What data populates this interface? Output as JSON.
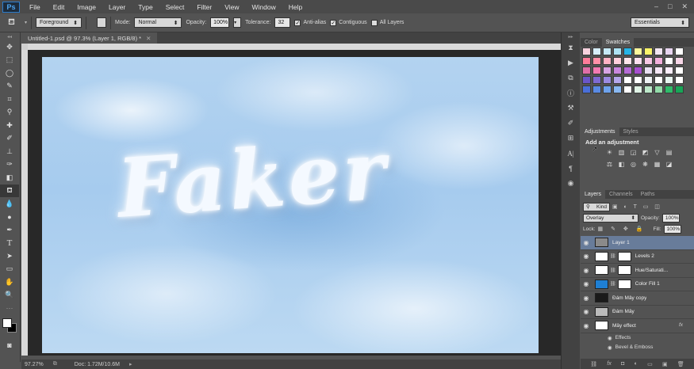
{
  "app": {
    "logo": "Ps"
  },
  "menu": [
    "File",
    "Edit",
    "Image",
    "Layer",
    "Type",
    "Select",
    "Filter",
    "View",
    "Window",
    "Help"
  ],
  "window_controls": [
    "–",
    "□",
    "✕"
  ],
  "options": {
    "fill_source": "Foreground",
    "mode_label": "Mode:",
    "mode_value": "Normal",
    "opacity_label": "Opacity:",
    "opacity_value": "100%",
    "tolerance_label": "Tolerance:",
    "tolerance_value": "32",
    "anti_alias": "Anti-alias",
    "contiguous": "Contiguous",
    "all_layers": "All Layers",
    "workspace": "Essentials"
  },
  "document": {
    "tab_title": "Untitled-1.psd @ 97.3% (Layer 1, RGB/8) *",
    "canvas_text": "Faker"
  },
  "status": {
    "zoom": "97.27%",
    "doc_info": "Doc: 1.72M/10.6M"
  },
  "color_panel": {
    "tab_color": "Color",
    "tab_swatches": "Swatches"
  },
  "swatch_colors": [
    "#f7d2de",
    "#d6eefa",
    "#c6e9f6",
    "#aee3f3",
    "#26b4e6",
    "#fff89c",
    "#fcf56a",
    "#f3e7f4",
    "#e8d5f0",
    "#ffffff",
    "#ff7c9a",
    "#ff90a8",
    "#ffb2c4",
    "#ffd0dc",
    "#ffe6ec",
    "#fde0f0",
    "#f8c8e6",
    "#f3b0dc",
    "#ffffff",
    "#f7d7e8",
    "#e06fa8",
    "#f27ab2",
    "#d8a4e3",
    "#c987de",
    "#b56bd6",
    "#a74fcf",
    "#e9e0f3",
    "#f5e7f6",
    "#fbeefc",
    "#ffffff",
    "#6a56c8",
    "#7e6ad2",
    "#9b8ae0",
    "#b4a6ea",
    "#ffffff",
    "#ffffff",
    "#eef2f4",
    "#ffffff",
    "#e6f4ef",
    "#ffffff",
    "#4a6fd8",
    "#5a8ae3",
    "#6ea2ec",
    "#89b8f1",
    "#ffffff",
    "#e0f4e6",
    "#bde9ca",
    "#92dca9",
    "#2fbb6a",
    "#18a557"
  ],
  "adjustments": {
    "tab_adjustments": "Adjustments",
    "tab_styles": "Styles",
    "title": "Add an adjustment",
    "icons": [
      "brightness-icon",
      "levels-icon",
      "curves-icon",
      "exposure-icon",
      "vibrance-icon",
      "hue-icon",
      "color-balance-icon",
      "bw-icon",
      "photo-filter-icon",
      "channel-mixer-icon",
      "color-lookup-icon",
      "invert-icon"
    ]
  },
  "layers": {
    "tab_layers": "Layers",
    "tab_channels": "Channels",
    "tab_paths": "Paths",
    "filter_kind": "Kind",
    "blend_mode": "Overlay",
    "opacity_label": "Opacity:",
    "opacity_value": "100%",
    "lock_label": "Lock:",
    "fill_label": "Fill:",
    "fill_value": "100%",
    "items": [
      {
        "name": "Layer 1",
        "thumb": "#8a8a8a",
        "selected": true,
        "fx": ""
      },
      {
        "name": "Levels 2",
        "thumb": "#ffffff",
        "selected": false,
        "fx": ""
      },
      {
        "name": "Hue/Saturati...",
        "thumb": "#ffffff",
        "selected": false,
        "fx": ""
      },
      {
        "name": "Color Fill 1",
        "thumb": "#1e7fd4",
        "selected": false,
        "fx": ""
      },
      {
        "name": "Đám Mây copy",
        "thumb": "#1a1a1a",
        "selected": false,
        "fx": ""
      },
      {
        "name": "Đám Mây",
        "thumb": "#bbbbbb",
        "selected": false,
        "fx": ""
      },
      {
        "name": "Mây effect",
        "thumb": "#ffffff",
        "selected": false,
        "fx": "fx"
      }
    ],
    "effects_label": "Effects",
    "effect_item": "Bevel & Emboss"
  }
}
